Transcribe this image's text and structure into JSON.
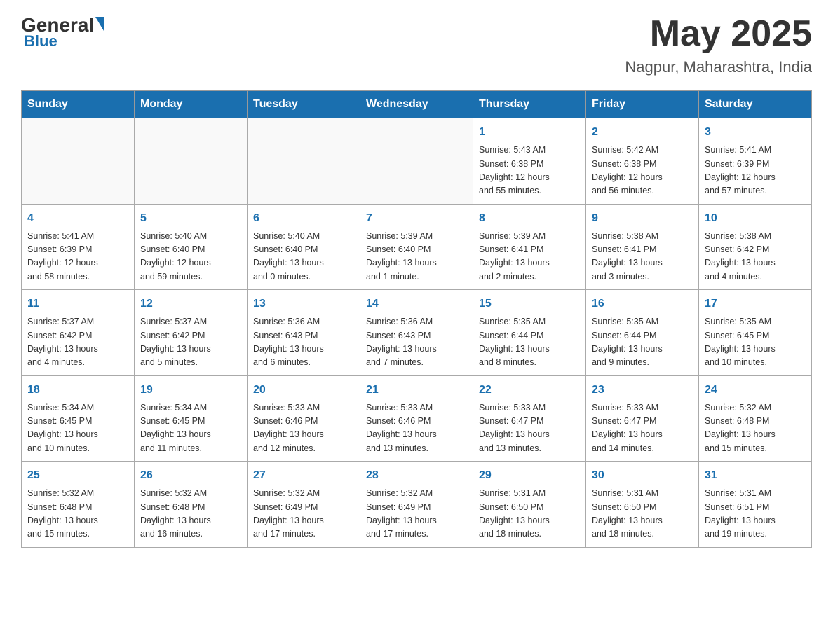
{
  "header": {
    "logo": {
      "general": "General",
      "blue": "Blue"
    },
    "title": "May 2025",
    "location": "Nagpur, Maharashtra, India"
  },
  "calendar": {
    "days_of_week": [
      "Sunday",
      "Monday",
      "Tuesday",
      "Wednesday",
      "Thursday",
      "Friday",
      "Saturday"
    ],
    "weeks": [
      [
        {
          "day": "",
          "info": ""
        },
        {
          "day": "",
          "info": ""
        },
        {
          "day": "",
          "info": ""
        },
        {
          "day": "",
          "info": ""
        },
        {
          "day": "1",
          "info": "Sunrise: 5:43 AM\nSunset: 6:38 PM\nDaylight: 12 hours\nand 55 minutes."
        },
        {
          "day": "2",
          "info": "Sunrise: 5:42 AM\nSunset: 6:38 PM\nDaylight: 12 hours\nand 56 minutes."
        },
        {
          "day": "3",
          "info": "Sunrise: 5:41 AM\nSunset: 6:39 PM\nDaylight: 12 hours\nand 57 minutes."
        }
      ],
      [
        {
          "day": "4",
          "info": "Sunrise: 5:41 AM\nSunset: 6:39 PM\nDaylight: 12 hours\nand 58 minutes."
        },
        {
          "day": "5",
          "info": "Sunrise: 5:40 AM\nSunset: 6:40 PM\nDaylight: 12 hours\nand 59 minutes."
        },
        {
          "day": "6",
          "info": "Sunrise: 5:40 AM\nSunset: 6:40 PM\nDaylight: 13 hours\nand 0 minutes."
        },
        {
          "day": "7",
          "info": "Sunrise: 5:39 AM\nSunset: 6:40 PM\nDaylight: 13 hours\nand 1 minute."
        },
        {
          "day": "8",
          "info": "Sunrise: 5:39 AM\nSunset: 6:41 PM\nDaylight: 13 hours\nand 2 minutes."
        },
        {
          "day": "9",
          "info": "Sunrise: 5:38 AM\nSunset: 6:41 PM\nDaylight: 13 hours\nand 3 minutes."
        },
        {
          "day": "10",
          "info": "Sunrise: 5:38 AM\nSunset: 6:42 PM\nDaylight: 13 hours\nand 4 minutes."
        }
      ],
      [
        {
          "day": "11",
          "info": "Sunrise: 5:37 AM\nSunset: 6:42 PM\nDaylight: 13 hours\nand 4 minutes."
        },
        {
          "day": "12",
          "info": "Sunrise: 5:37 AM\nSunset: 6:42 PM\nDaylight: 13 hours\nand 5 minutes."
        },
        {
          "day": "13",
          "info": "Sunrise: 5:36 AM\nSunset: 6:43 PM\nDaylight: 13 hours\nand 6 minutes."
        },
        {
          "day": "14",
          "info": "Sunrise: 5:36 AM\nSunset: 6:43 PM\nDaylight: 13 hours\nand 7 minutes."
        },
        {
          "day": "15",
          "info": "Sunrise: 5:35 AM\nSunset: 6:44 PM\nDaylight: 13 hours\nand 8 minutes."
        },
        {
          "day": "16",
          "info": "Sunrise: 5:35 AM\nSunset: 6:44 PM\nDaylight: 13 hours\nand 9 minutes."
        },
        {
          "day": "17",
          "info": "Sunrise: 5:35 AM\nSunset: 6:45 PM\nDaylight: 13 hours\nand 10 minutes."
        }
      ],
      [
        {
          "day": "18",
          "info": "Sunrise: 5:34 AM\nSunset: 6:45 PM\nDaylight: 13 hours\nand 10 minutes."
        },
        {
          "day": "19",
          "info": "Sunrise: 5:34 AM\nSunset: 6:45 PM\nDaylight: 13 hours\nand 11 minutes."
        },
        {
          "day": "20",
          "info": "Sunrise: 5:33 AM\nSunset: 6:46 PM\nDaylight: 13 hours\nand 12 minutes."
        },
        {
          "day": "21",
          "info": "Sunrise: 5:33 AM\nSunset: 6:46 PM\nDaylight: 13 hours\nand 13 minutes."
        },
        {
          "day": "22",
          "info": "Sunrise: 5:33 AM\nSunset: 6:47 PM\nDaylight: 13 hours\nand 13 minutes."
        },
        {
          "day": "23",
          "info": "Sunrise: 5:33 AM\nSunset: 6:47 PM\nDaylight: 13 hours\nand 14 minutes."
        },
        {
          "day": "24",
          "info": "Sunrise: 5:32 AM\nSunset: 6:48 PM\nDaylight: 13 hours\nand 15 minutes."
        }
      ],
      [
        {
          "day": "25",
          "info": "Sunrise: 5:32 AM\nSunset: 6:48 PM\nDaylight: 13 hours\nand 15 minutes."
        },
        {
          "day": "26",
          "info": "Sunrise: 5:32 AM\nSunset: 6:48 PM\nDaylight: 13 hours\nand 16 minutes."
        },
        {
          "day": "27",
          "info": "Sunrise: 5:32 AM\nSunset: 6:49 PM\nDaylight: 13 hours\nand 17 minutes."
        },
        {
          "day": "28",
          "info": "Sunrise: 5:32 AM\nSunset: 6:49 PM\nDaylight: 13 hours\nand 17 minutes."
        },
        {
          "day": "29",
          "info": "Sunrise: 5:31 AM\nSunset: 6:50 PM\nDaylight: 13 hours\nand 18 minutes."
        },
        {
          "day": "30",
          "info": "Sunrise: 5:31 AM\nSunset: 6:50 PM\nDaylight: 13 hours\nand 18 minutes."
        },
        {
          "day": "31",
          "info": "Sunrise: 5:31 AM\nSunset: 6:51 PM\nDaylight: 13 hours\nand 19 minutes."
        }
      ]
    ]
  }
}
